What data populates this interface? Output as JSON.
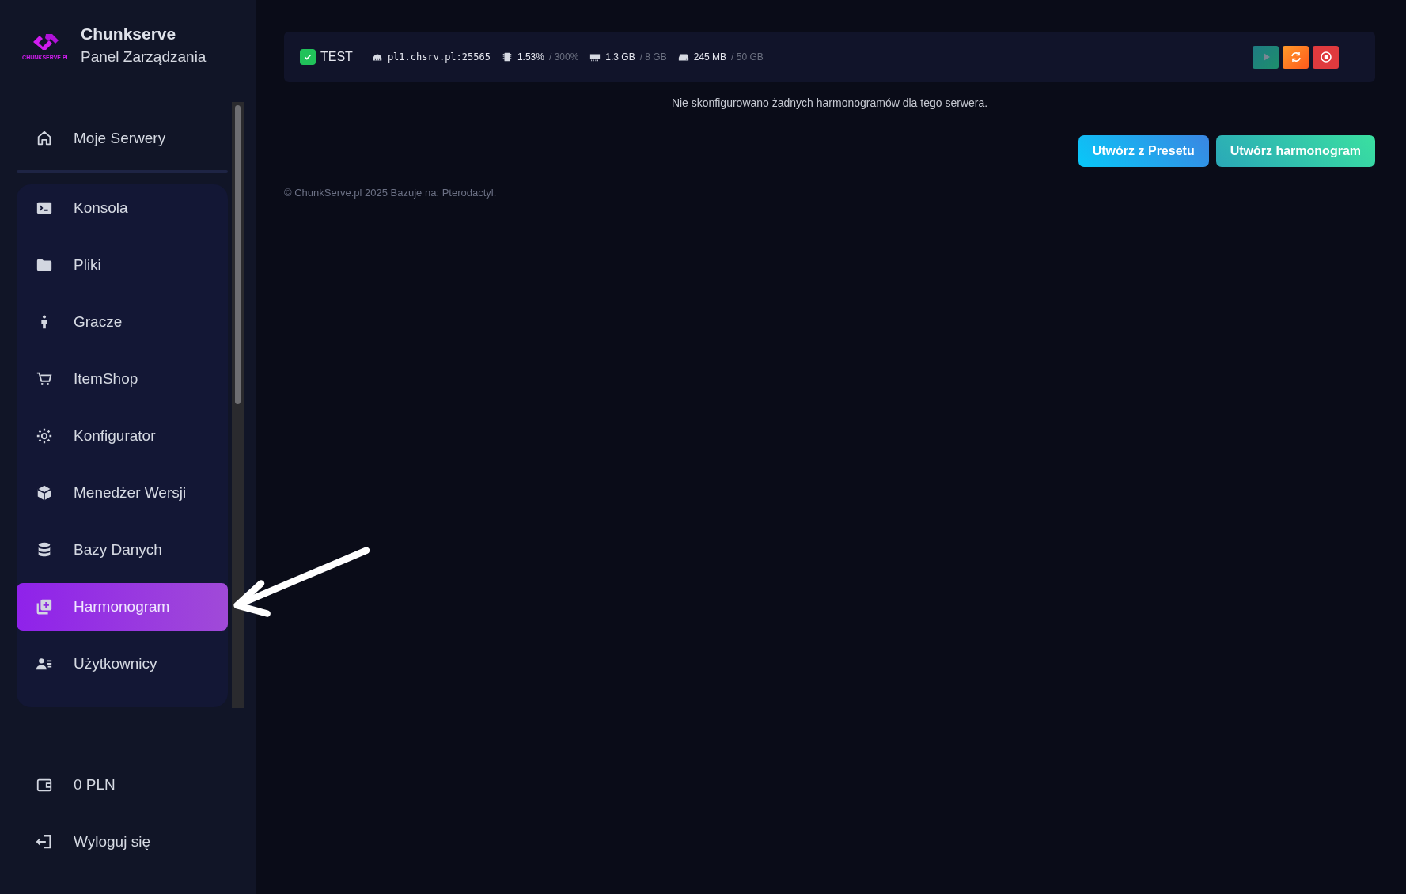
{
  "brand": {
    "name": "Chunkserve",
    "subtitle": "Panel Zarządzania",
    "logo_caption": "CHUNKSERVE.PL"
  },
  "sidebar": {
    "top_items": [
      {
        "label": "Moje Serwery",
        "selected": false
      }
    ],
    "server_items": [
      {
        "label": "Konsola",
        "selected": false
      },
      {
        "label": "Pliki",
        "selected": false
      },
      {
        "label": "Gracze",
        "selected": false
      },
      {
        "label": "ItemShop",
        "selected": false
      },
      {
        "label": "Konfigurator",
        "selected": false
      },
      {
        "label": "Menedżer Wersji",
        "selected": false
      },
      {
        "label": "Bazy Danych",
        "selected": false
      },
      {
        "label": "Harmonogram",
        "selected": true
      },
      {
        "label": "Użytkownicy",
        "selected": false
      }
    ],
    "balance": "0 PLN",
    "logout": "Wyloguj się"
  },
  "server_bar": {
    "name": "TEST",
    "online": true,
    "address": "pl1.chsrv.pl:25565",
    "cpu": "1.53%",
    "cpu_limit": "/ 300%",
    "memory": "1.3 GB",
    "memory_limit": "/ 8 GB",
    "disk": "245 MB",
    "disk_limit": "/ 50 GB",
    "power_buttons": [
      {
        "kind": "start",
        "disabled": true
      },
      {
        "kind": "restart",
        "disabled": false
      },
      {
        "kind": "stop",
        "disabled": false
      }
    ]
  },
  "empty_message": "Nie skonfigurowano żadnych harmonogramów dla tego serwera.",
  "actions": [
    {
      "kind": "preset",
      "label": "Utwórz z Presetu"
    },
    {
      "kind": "create",
      "label": "Utwórz harmonogram"
    }
  ],
  "footer": "© ChunkServe.pl 2025 Bazuje na: Pterodactyl."
}
